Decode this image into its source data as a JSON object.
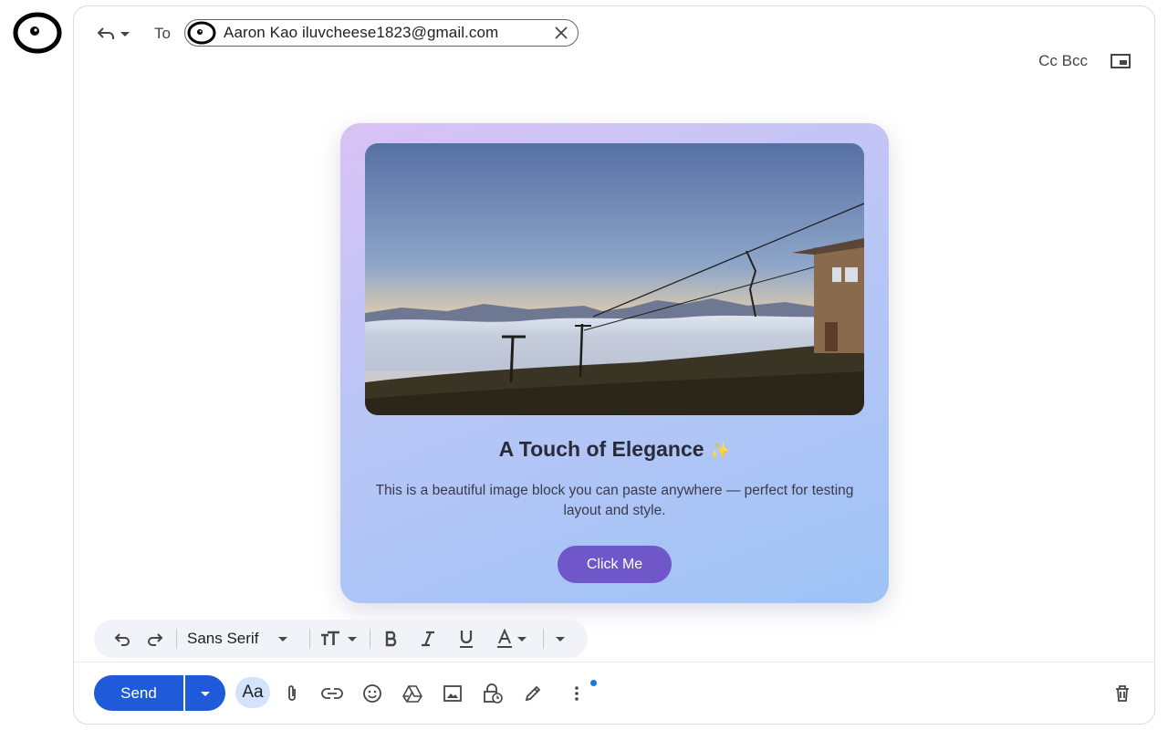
{
  "header": {
    "to_label": "To",
    "recipient": "Aaron Kao iluvcheese1823@gmail.com",
    "cc_bcc": "Cc Bcc"
  },
  "card": {
    "title": "A Touch of Elegance",
    "sparkle": "✨",
    "description": "This is a beautiful image block you can paste anywhere — perfect for testing layout and style.",
    "button_label": "Click Me"
  },
  "format_bar": {
    "font": "Sans Serif"
  },
  "footer": {
    "send_label": "Send",
    "text_formatting_label": "Aa"
  },
  "colors": {
    "send_blue": "#1f5bd8",
    "card_button": "#6f57c9",
    "formatting_highlight": "#d3e3fd",
    "notification_dot": "#1a73e8"
  }
}
